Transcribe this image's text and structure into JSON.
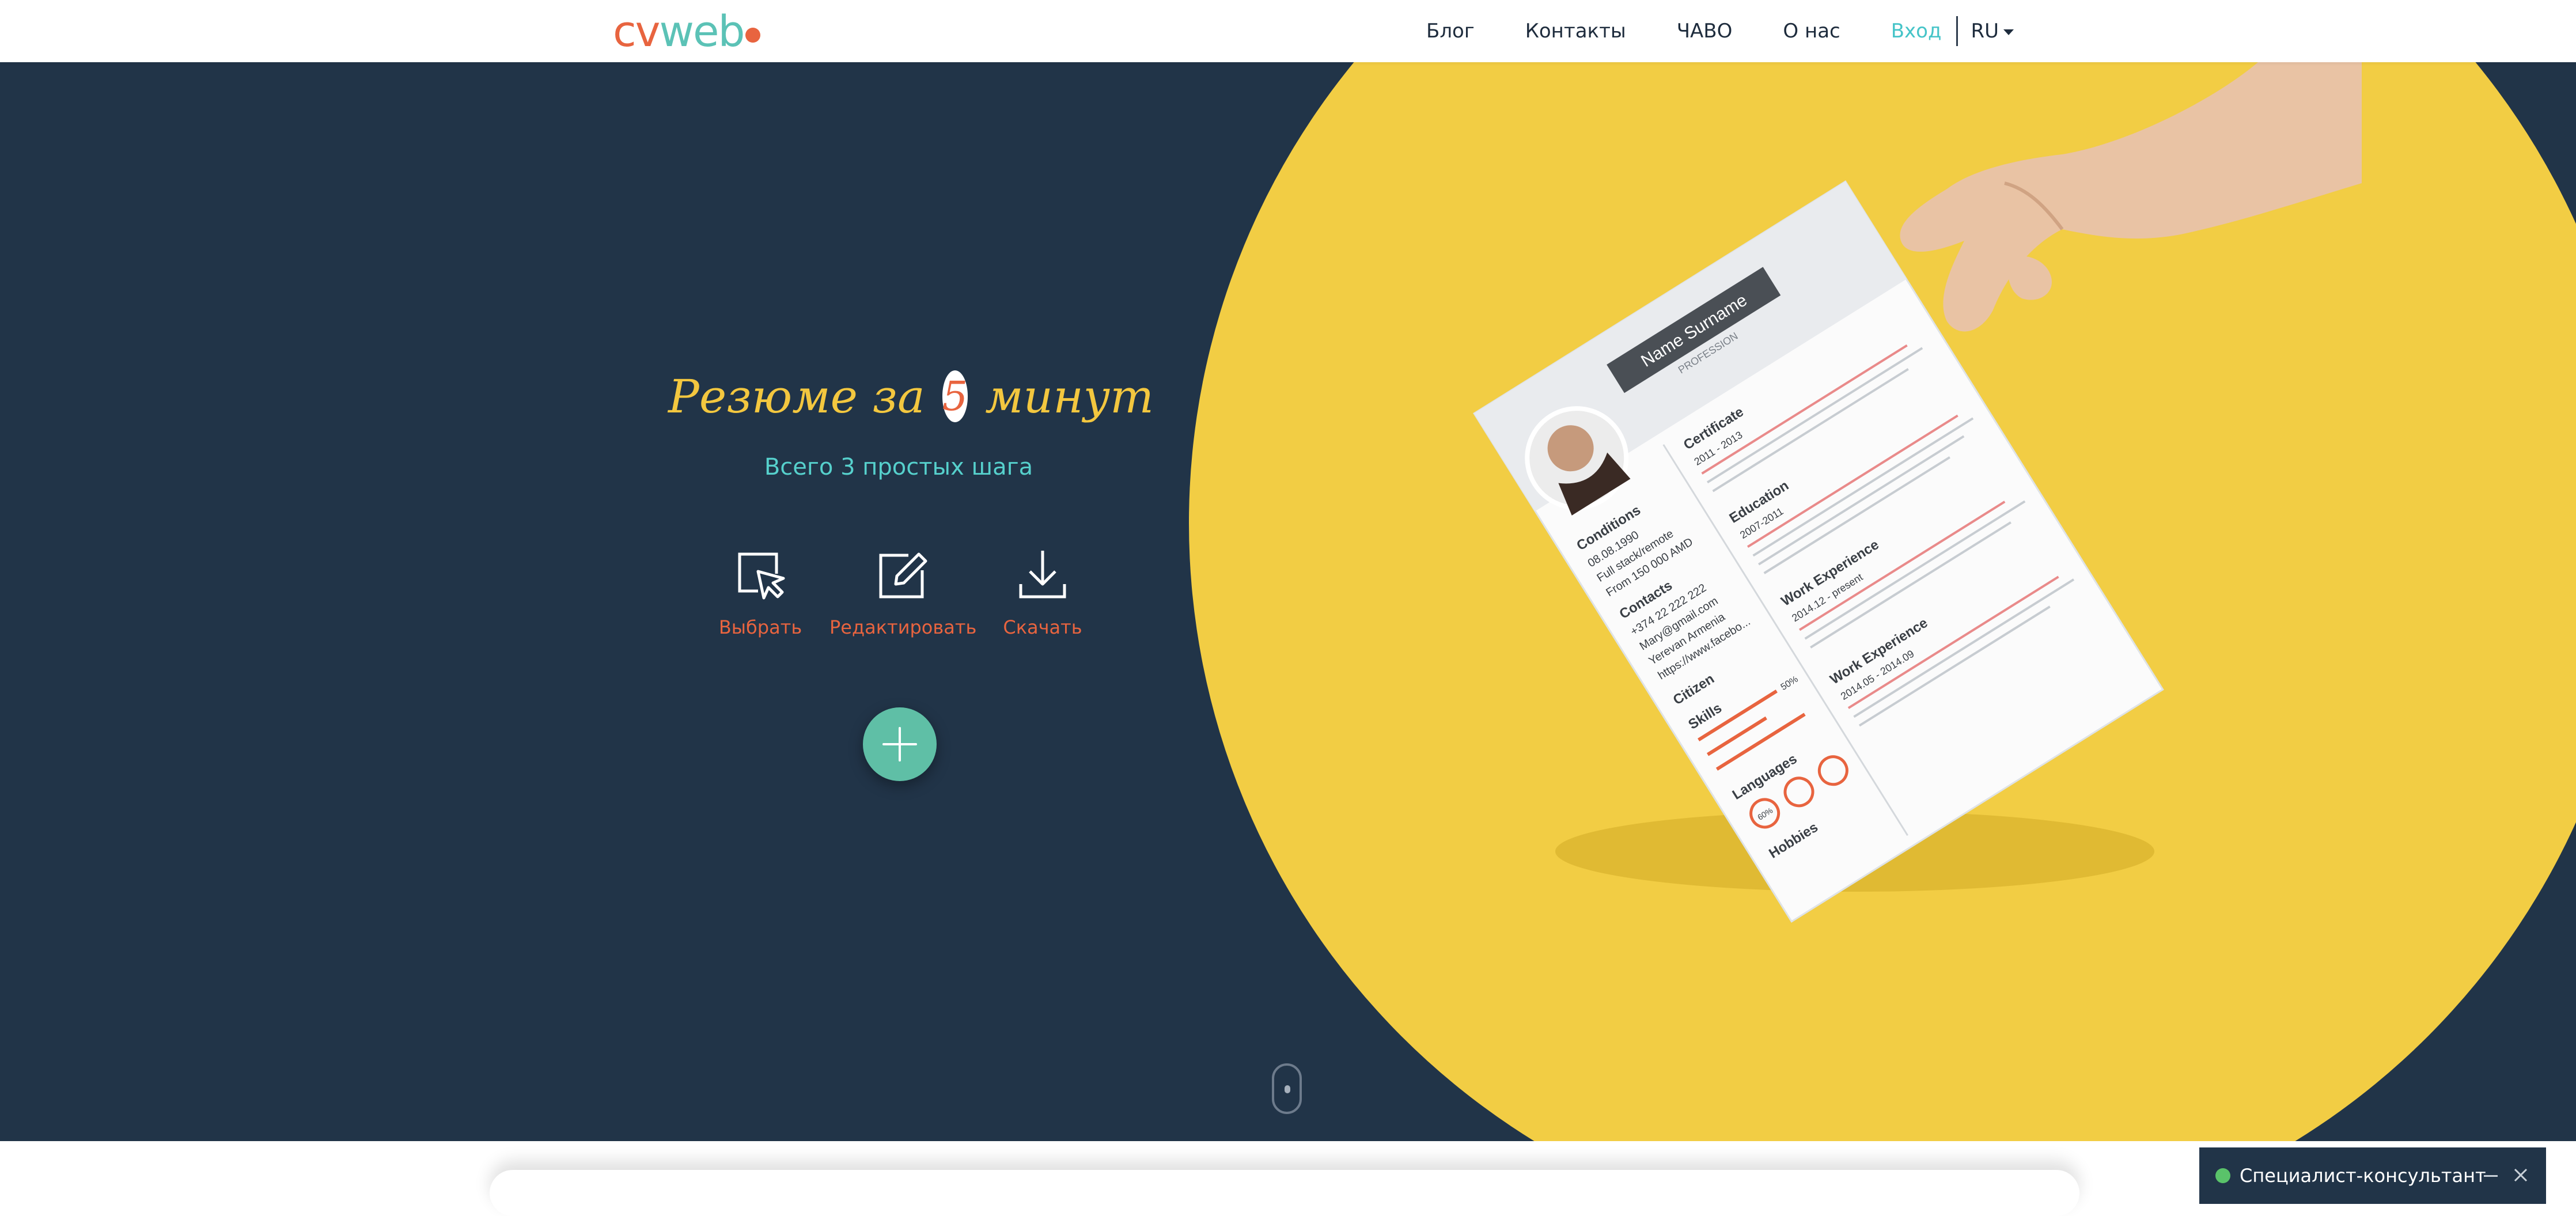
{
  "header": {
    "logo": {
      "part1": "cv",
      "part2": "w",
      "part3": "eb"
    },
    "nav": {
      "blog": "Блог",
      "contacts": "Контакты",
      "faq": "ЧАВО",
      "about": "О нас",
      "login": "Вход",
      "lang": "RU"
    }
  },
  "hero": {
    "title_before": "Резюме за",
    "title_number": "5",
    "title_after": "минут",
    "subtitle": "Всего 3 простых шага",
    "steps": [
      {
        "label": "Выбрать",
        "icon": "cursor-select-icon"
      },
      {
        "label": "Редактировать",
        "icon": "edit-icon"
      },
      {
        "label": "Скачать",
        "icon": "download-icon"
      }
    ],
    "plus_icon": "plus-icon"
  },
  "resume": {
    "name": "Name Surname",
    "profession": "PROFESSION",
    "sections": {
      "conditions": "Conditions",
      "contacts": "Contacts",
      "citizen": "Citizen",
      "skills": "Skills",
      "languages": "Languages",
      "hobbies": "Hobbies",
      "certificate": "Certificate",
      "education": "Education",
      "work_experience": "Work Experience",
      "work_experience_2": "Work Experience"
    },
    "details": {
      "birth": "08.08.1990",
      "stack": "Full stack/remote",
      "from": "From 150 000 AMD",
      "phone": "+374 22 222 222",
      "email": "Mary@gmail.com",
      "address": "Yerevan Armenia",
      "site": "https://www.facebo...",
      "period1": "2011 - 2013",
      "period2": "2007-2011",
      "period3": "2014.12 - present",
      "period4": "2014.05 - 2014.09",
      "skill_percent": "50%",
      "lang_percent": "60%"
    }
  },
  "chat": {
    "label": "Специалист-консультант"
  },
  "colors": {
    "hero_bg": "#213448",
    "accent_yellow": "#f2cd44",
    "accent_orange": "#e8643f",
    "accent_teal": "#56d0cc",
    "plus_green": "#5fbfa6"
  }
}
